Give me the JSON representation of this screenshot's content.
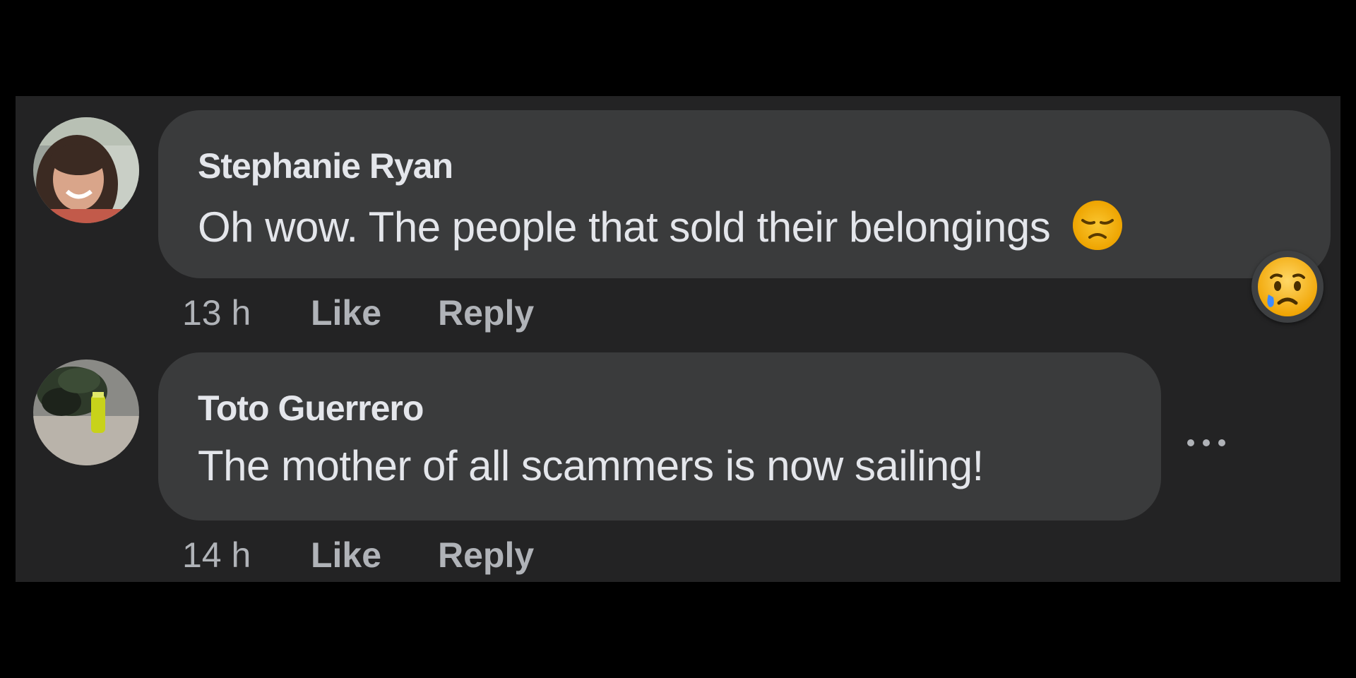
{
  "comments": [
    {
      "author": "Stephanie Ryan",
      "text": "Oh wow. The people that sold their belongings",
      "inline_emoji": "sad-face-emoji",
      "time": "13 h",
      "like_label": "Like",
      "reply_label": "Reply",
      "reaction": "sad-crying-reaction"
    },
    {
      "author": "Toto Guerrero",
      "text": "The mother of all scammers is now sailing!",
      "time": "14 h",
      "like_label": "Like",
      "reply_label": "Reply",
      "more_icon": "more-options-icon"
    }
  ],
  "colors": {
    "background": "#000000",
    "panel": "#232324",
    "bubble": "#3a3b3c",
    "text_primary": "#e4e6eb",
    "text_secondary": "#b0b3b8"
  }
}
